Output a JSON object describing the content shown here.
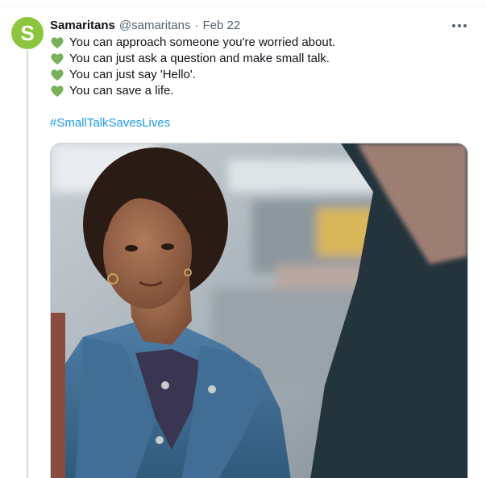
{
  "tweet": {
    "author_name": "Samaritans",
    "handle": "@samaritans",
    "separator": "·",
    "date": "Feb 22",
    "avatar_letter": "S",
    "lines": [
      "You can approach someone you're worried about.",
      "You can just ask a question and make small talk.",
      "You can just say 'Hello'.",
      "You can save a life."
    ],
    "hashtag": "#SmallTalkSavesLives"
  },
  "icons": {
    "line_emoji": "green-heart-icon",
    "more": "more-options-icon"
  },
  "colors": {
    "avatar_bg": "#8cc63f",
    "heart": "#78b159",
    "link": "#1d9bf0",
    "text": "#0f1419",
    "muted": "#536471"
  }
}
